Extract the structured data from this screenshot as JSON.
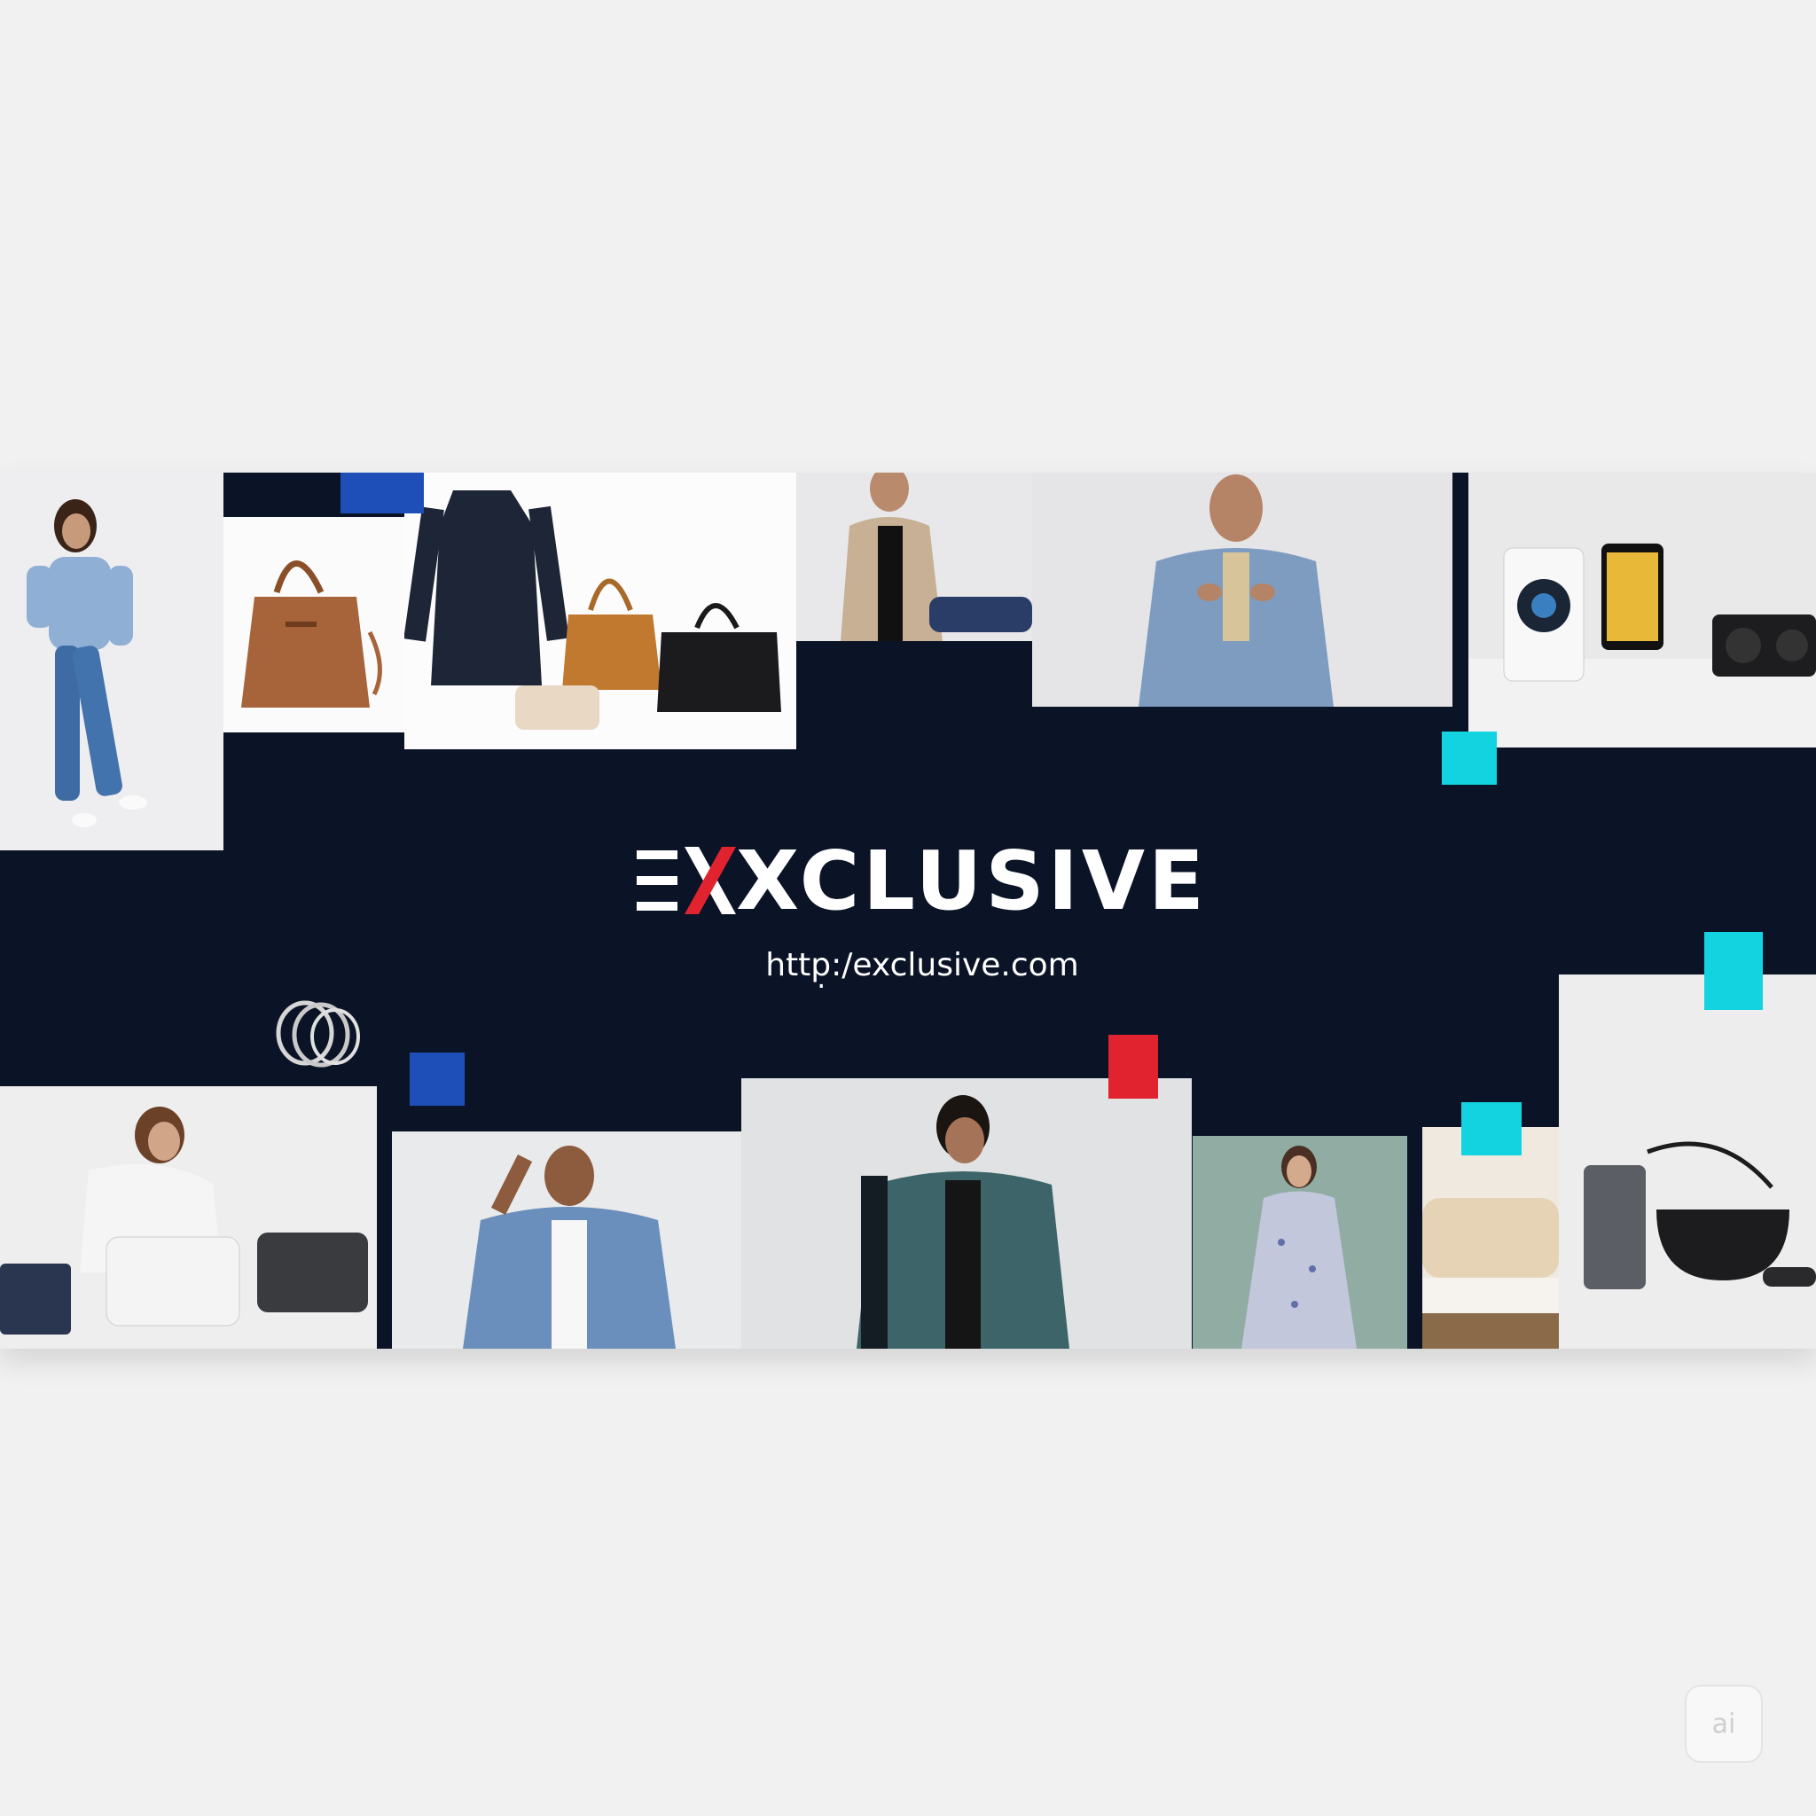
{
  "brand": {
    "name": "XCLUSIVE",
    "url": "http̣:/exclusive.com"
  },
  "badge": {
    "label": "ai"
  },
  "colors": {
    "background": "#f1f1f1",
    "banner": "#0b1426",
    "accent_red": "#e0232f",
    "accent_blue": "#1e4fb8",
    "accent_cyan": "#14d3e0",
    "text": "#ffffff"
  },
  "photos": [
    "woman-in-denim-shirt-and-jeans",
    "brown-leather-tote-bag",
    "navy-coat-and-handbags",
    "man-in-beige-jacket",
    "man-in-denim-jacket",
    "camera-smartphone-speaker-electronics",
    "woman-with-white-bags",
    "man-in-denim-jacket-posing",
    "man-in-teal-coat",
    "woman-in-floral-dress",
    "beige-bedding",
    "black-kitchen-appliances"
  ]
}
